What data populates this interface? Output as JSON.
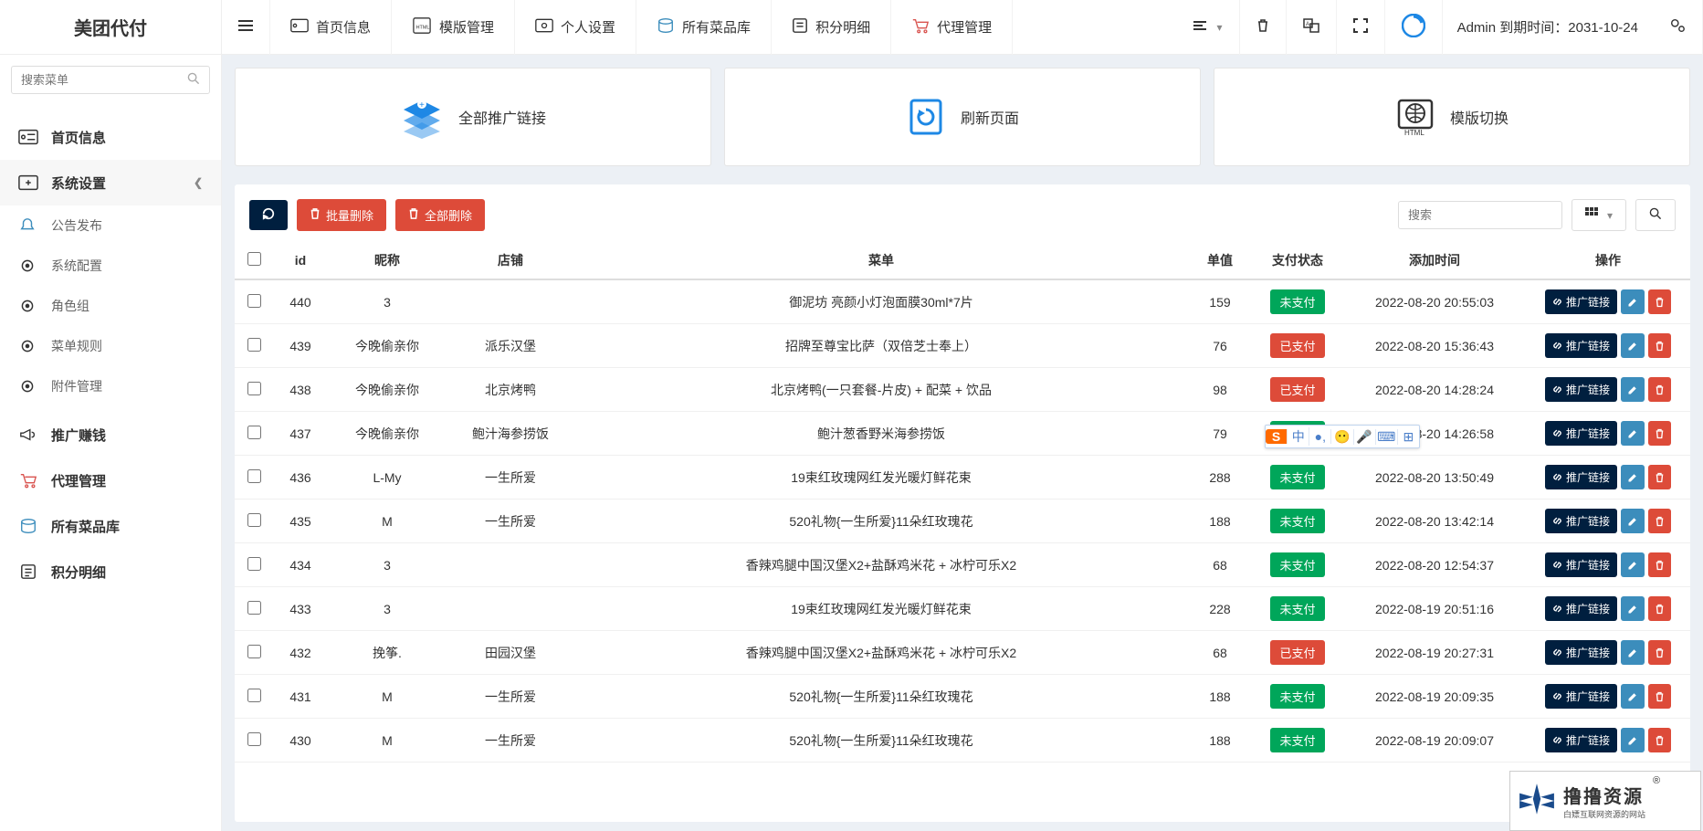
{
  "brand": "美团代付",
  "search_placeholder": "搜索菜单",
  "sidebar": {
    "home": "首页信息",
    "sys": "系统设置",
    "sub": {
      "announce": "公告发布",
      "config": "系统配置",
      "roles": "角色组",
      "menurule": "菜单规则",
      "attach": "附件管理"
    },
    "promo": "推广赚钱",
    "agent": "代理管理",
    "allmenu": "所有菜品库",
    "points": "积分明细"
  },
  "topnav": {
    "home": "首页信息",
    "tpl": "模版管理",
    "personal": "个人设置",
    "allmenu": "所有菜品库",
    "points": "积分明细",
    "agent": "代理管理"
  },
  "expiry": "Admin 到期时间：2031-10-24",
  "cards": {
    "promo": "全部推广链接",
    "refresh": "刷新页面",
    "tplswitch": "模版切换"
  },
  "toolbar": {
    "batchdel": "批量删除",
    "alldel": "全部删除",
    "search_ph": "搜索"
  },
  "columns": {
    "id": "id",
    "nick": "昵称",
    "shop": "店铺",
    "menu": "菜单",
    "price": "单值",
    "paystatus": "支付状态",
    "addtime": "添加时间",
    "ops": "操作"
  },
  "status_labels": {
    "paid": "已支付",
    "unpaid": "未支付"
  },
  "op_labels": {
    "promo": "推广链接"
  },
  "rows": [
    {
      "id": "440",
      "nick": "3",
      "shop": "",
      "menu": "御泥坊 亮颜小灯泡面膜30ml*7片",
      "price": "159",
      "status": "unpaid",
      "time": "2022-08-20 20:55:03"
    },
    {
      "id": "439",
      "nick": "今晚偷亲你",
      "shop": "派乐汉堡",
      "menu": "招牌至尊宝比萨（双倍芝士奉上）",
      "price": "76",
      "status": "paid",
      "time": "2022-08-20 15:36:43"
    },
    {
      "id": "438",
      "nick": "今晚偷亲你",
      "shop": "北京烤鸭",
      "menu": "北京烤鸭(一只套餐-片皮) + 配菜 + 饮品",
      "price": "98",
      "status": "paid",
      "time": "2022-08-20 14:28:24"
    },
    {
      "id": "437",
      "nick": "今晚偷亲你",
      "shop": "鲍汁海参捞饭",
      "menu": "鲍汁葱香野米海参捞饭",
      "price": "79",
      "status": "unpaid",
      "time": "2022-08-20 14:26:58"
    },
    {
      "id": "436",
      "nick": "L-My",
      "shop": "一生所爱",
      "menu": "19束红玫瑰网红发光暖灯鲜花束",
      "price": "288",
      "status": "unpaid",
      "time": "2022-08-20 13:50:49"
    },
    {
      "id": "435",
      "nick": "M",
      "shop": "一生所爱",
      "menu": "520礼物{一生所爱}11朵红玫瑰花",
      "price": "188",
      "status": "unpaid",
      "time": "2022-08-20 13:42:14"
    },
    {
      "id": "434",
      "nick": "3",
      "shop": "",
      "menu": "香辣鸡腿中国汉堡X2+盐酥鸡米花 + 冰柠可乐X2",
      "price": "68",
      "status": "unpaid",
      "time": "2022-08-20 12:54:37"
    },
    {
      "id": "433",
      "nick": "3",
      "shop": "",
      "menu": "19束红玫瑰网红发光暖灯鲜花束",
      "price": "228",
      "status": "unpaid",
      "time": "2022-08-19 20:51:16"
    },
    {
      "id": "432",
      "nick": "挽筝.",
      "shop": "田园汉堡",
      "menu": "香辣鸡腿中国汉堡X2+盐酥鸡米花 + 冰柠可乐X2",
      "price": "68",
      "status": "paid",
      "time": "2022-08-19 20:27:31"
    },
    {
      "id": "431",
      "nick": "M",
      "shop": "一生所爱",
      "menu": "520礼物{一生所爱}11朵红玫瑰花",
      "price": "188",
      "status": "unpaid",
      "time": "2022-08-19 20:09:35"
    },
    {
      "id": "430",
      "nick": "M",
      "shop": "一生所爱",
      "menu": "520礼物{一生所爱}11朵红玫瑰花",
      "price": "188",
      "status": "unpaid",
      "time": "2022-08-19 20:09:07"
    }
  ],
  "watermark": {
    "big": "撸撸资源",
    "small": "白嫖互联网资源的网站"
  },
  "ime": {
    "logo": "S",
    "c1": "中",
    "c2": "●,",
    "c3": "😶",
    "c4": "🎤",
    "c5": "⌨",
    "c6": "⊞"
  }
}
